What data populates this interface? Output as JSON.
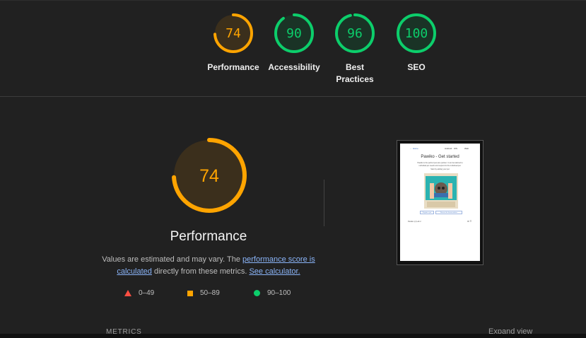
{
  "summary_gauges": [
    {
      "score": "74",
      "label": "Performance",
      "color": "#ffa400",
      "fill": "#3b2f1c",
      "fraction": 0.74
    },
    {
      "score": "90",
      "label": "Accessibility",
      "color": "#0cce6b",
      "fill": "#1a3326",
      "fraction": 0.9
    },
    {
      "score": "96",
      "label_line1": "Best",
      "label_line2": "Practices",
      "color": "#0cce6b",
      "fill": "#1a3326",
      "fraction": 0.96
    },
    {
      "score": "100",
      "label": "SEO",
      "color": "#0cce6b",
      "fill": "#1a3326",
      "fraction": 1.0
    }
  ],
  "performance": {
    "score": "74",
    "fraction": 0.74,
    "color": "#ffa400",
    "fill": "#3b2f1c",
    "title": "Performance",
    "desc_part1": "Values are estimated and may vary. The ",
    "desc_link1": "performance score is calculated",
    "desc_part2": " directly from these metrics. ",
    "desc_link2": "See calculator."
  },
  "legend": [
    {
      "range": "0–49",
      "shape": "triangle",
      "color": "#ff4e42"
    },
    {
      "range": "50–89",
      "shape": "square",
      "color": "#ffa400"
    },
    {
      "range": "90–100",
      "shape": "circle",
      "color": "#0cce6b"
    }
  ],
  "screenshot": {
    "nav_home": "← Home",
    "nav_1": "Android",
    "nav_2": "iOS",
    "nav_3": "Web",
    "heading": "Pawiko - Get started",
    "sub": "Pawiko is the perfect pet-care partner. It can be tailored to individual pet needs and respond to the individual pet.",
    "sub2": "Start by adding your pet",
    "btn1": "Register a pet",
    "btn2": "Browse the documentation",
    "footer_left": "Pawiko (c) Lab 2",
    "footer_right": "⚙ ☰"
  },
  "bottom": {
    "metrics_label": "METRICS",
    "expand_label": "Expand view"
  }
}
